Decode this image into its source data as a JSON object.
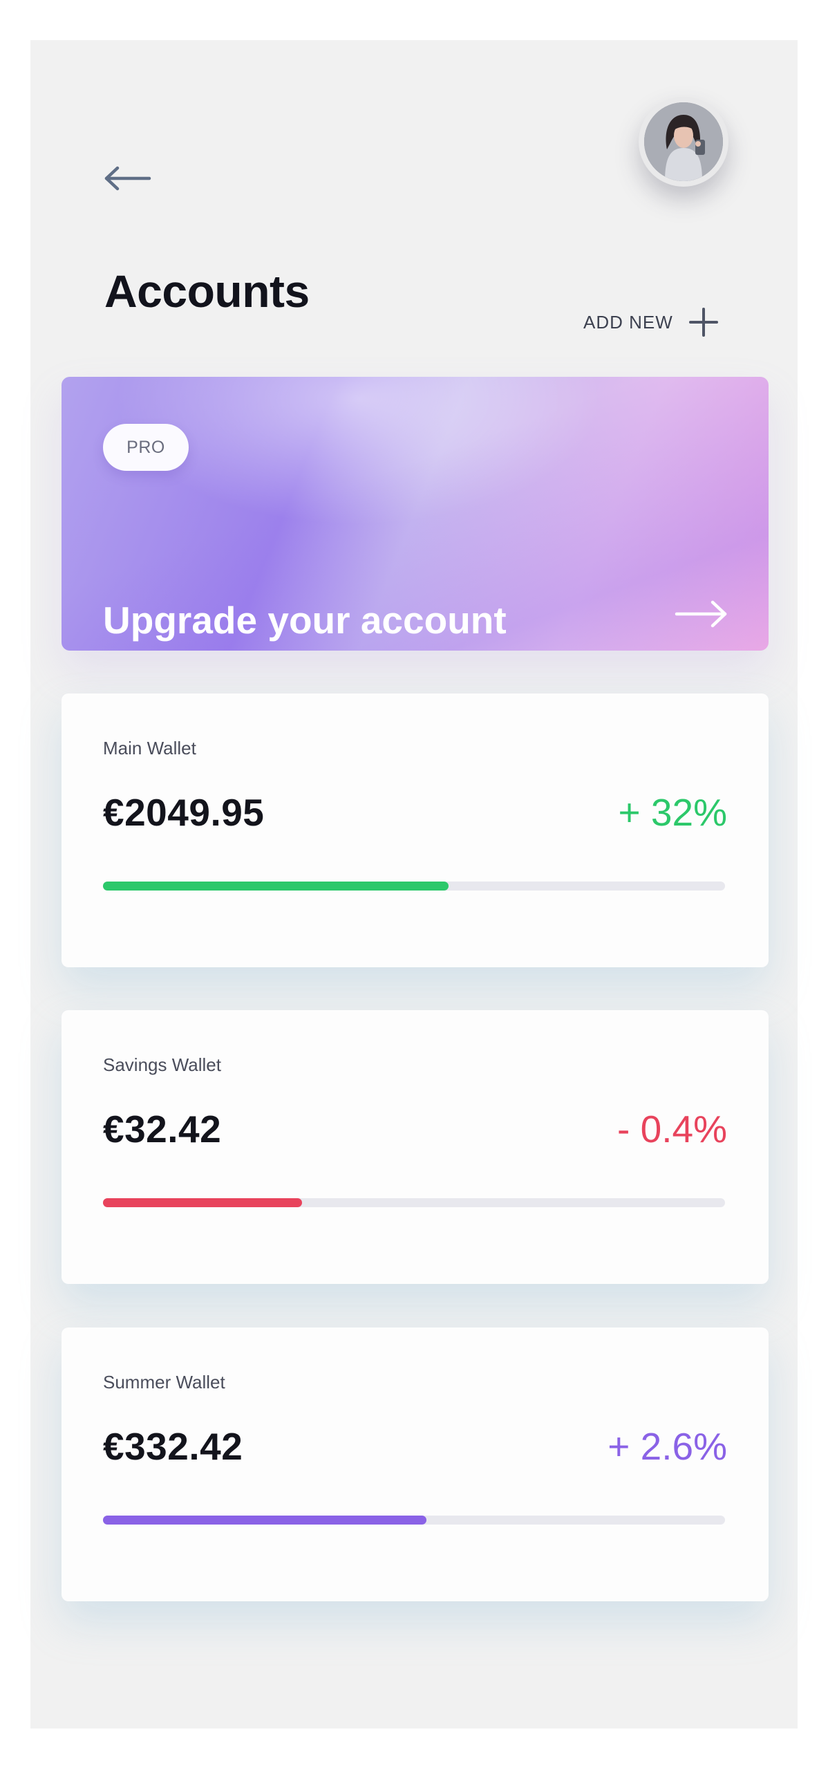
{
  "header": {
    "title": "Accounts",
    "add_new_label": "ADD NEW"
  },
  "upgrade": {
    "badge": "PRO",
    "text": "Upgrade your account"
  },
  "wallets": [
    {
      "name": "Main Wallet",
      "amount": "€2049.95",
      "change": "+ 32%",
      "color": "#2cc86a",
      "progress": 0.556
    },
    {
      "name": "Savings Wallet",
      "amount": "€32.42",
      "change": "- 0.4%",
      "color": "#e8435c",
      "progress": 0.32
    },
    {
      "name": "Summer Wallet",
      "amount": "€332.42",
      "change": "+ 2.6%",
      "color": "#8a62e6",
      "progress": 0.52
    }
  ],
  "colors": {
    "positive": "#2cc86a",
    "negative": "#e8435c",
    "accent": "#8a62e6"
  },
  "icons": {
    "back": "arrow-left-icon",
    "add": "plus-icon",
    "forward": "arrow-right-icon"
  }
}
